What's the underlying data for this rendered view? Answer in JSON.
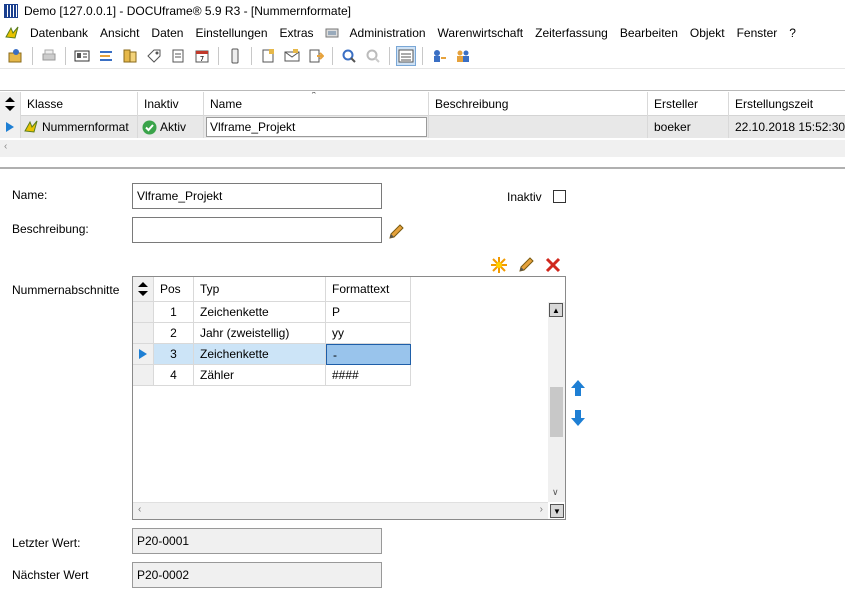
{
  "window": {
    "title": "Demo [127.0.0.1] - DOCUframe® 5.9 R3 - [Nummernformate]"
  },
  "menu": {
    "items": [
      "Datenbank",
      "Ansicht",
      "Daten",
      "Einstellungen",
      "Extras",
      "Administration",
      "Warenwirtschaft",
      "Zeiterfassung",
      "Bearbeiten",
      "Objekt",
      "Fenster",
      "?"
    ]
  },
  "top_grid": {
    "columns": [
      "Klasse",
      "Inaktiv",
      "Name",
      "Beschreibung",
      "Ersteller",
      "Erstellungszeit"
    ],
    "row": {
      "klasse": "Nummernformat",
      "inaktiv": "Aktiv",
      "name": "Vlframe_Projekt",
      "beschreibung": "",
      "ersteller": "boeker",
      "erstellungszeit": "22.10.2018 15:52:30"
    }
  },
  "form": {
    "name_label": "Name:",
    "name_value": "Vlframe_Projekt",
    "inaktiv_label": "Inaktiv",
    "beschreibung_label": "Beschreibung:",
    "beschreibung_value": "",
    "nummernabschnitte_label": "Nummernabschnitte",
    "letzter_label": "Letzter Wert:",
    "letzter_value": "P20-0001",
    "naechster_label": "Nächster Wert",
    "naechster_value": "P20-0002"
  },
  "sections_grid": {
    "columns": [
      "Pos",
      "Typ",
      "Formattext"
    ],
    "rows": [
      {
        "pos": "1",
        "typ": "Zeichenkette",
        "formattext": "P"
      },
      {
        "pos": "2",
        "typ": "Jahr (zweistellig)",
        "formattext": "yy"
      },
      {
        "pos": "3",
        "typ": "Zeichenkette",
        "formattext": "-"
      },
      {
        "pos": "4",
        "typ": "Zähler",
        "formattext": "####"
      }
    ],
    "selected_row": 3
  },
  "colors": {
    "selection": "#cce4f7",
    "accent_blue": "#1e7fd4"
  }
}
